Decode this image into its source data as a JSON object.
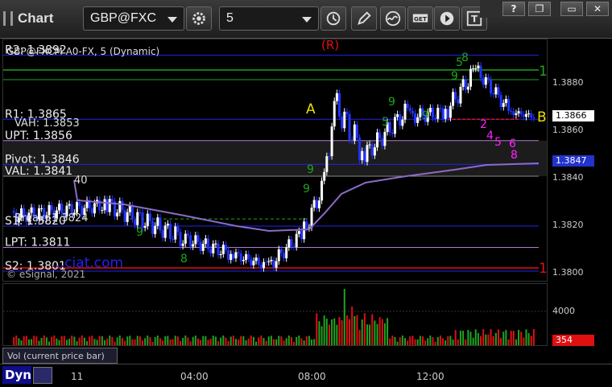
{
  "toolbar": {
    "tab_label": "Chart",
    "symbol": "GBP@FXC",
    "interval": "5"
  },
  "window": {
    "help": "?",
    "restore_small": "❐",
    "minimize": "▭",
    "close": "✕"
  },
  "chart": {
    "description": "GBP@FXCM A0-FX, 5 (Dynamic)",
    "copyright": "© eSignal, 2021",
    "watermark": "...ciat.com",
    "y_ticks": [
      "1.3880",
      "1.3860",
      "1.3840",
      "1.3820",
      "1.3800"
    ],
    "current_price_tag": "1.3866",
    "vwap_tag": "1.3847",
    "levels": [
      {
        "label": "R2: 1.3892",
        "price": 1.3892,
        "color": "#2222ee"
      },
      {
        "label": "R1: 1.3865",
        "price": 1.3865,
        "color": "#2222ee"
      },
      {
        "label": "UPT: 1.3856",
        "price": 1.3856,
        "color": "#b07ad8"
      },
      {
        "label": "Pivot: 1.3846",
        "price": 1.3846,
        "color": "#2222ee"
      },
      {
        "label": "VAL: 1.3841",
        "price": 1.3841,
        "color": "#888888"
      },
      {
        "label": "S1: 1.3820",
        "price": 1.382,
        "color": "#2222ee"
      },
      {
        "label": "LPT: 1.3811",
        "price": 1.3811,
        "color": "#b07ad8"
      },
      {
        "label": "S2: 1.3801",
        "price": 1.3801,
        "color": "#2222ee"
      }
    ],
    "overlap_texts": [
      "VAH: 1.3853",
      "Break: 1.3824",
      "40"
    ],
    "markers": {
      "a": "A",
      "b": "B",
      "r": "(R)",
      "one_top": "1",
      "one_bottom": "1"
    },
    "seq_green": [
      "9",
      "8",
      "9",
      "9",
      "9",
      "5",
      "9",
      "8",
      "9",
      "5"
    ],
    "seq_magenta": [
      "2",
      "4",
      "5",
      "6",
      "8"
    ]
  },
  "volume": {
    "label": "Vol (current price bar)",
    "y_tick": "4000",
    "current_tag": "354"
  },
  "time_axis": {
    "labels": [
      "11",
      "04:00",
      "08:00",
      "12:00"
    ]
  },
  "status": {
    "dyn": "Dyn"
  },
  "colors": {
    "up_bar": "#ffffff",
    "down_bar": "#2233ff",
    "green": "#1fa31f",
    "red": "#e01010",
    "magenta": "#ff22ff",
    "vwap": "#8c6bc9"
  }
}
